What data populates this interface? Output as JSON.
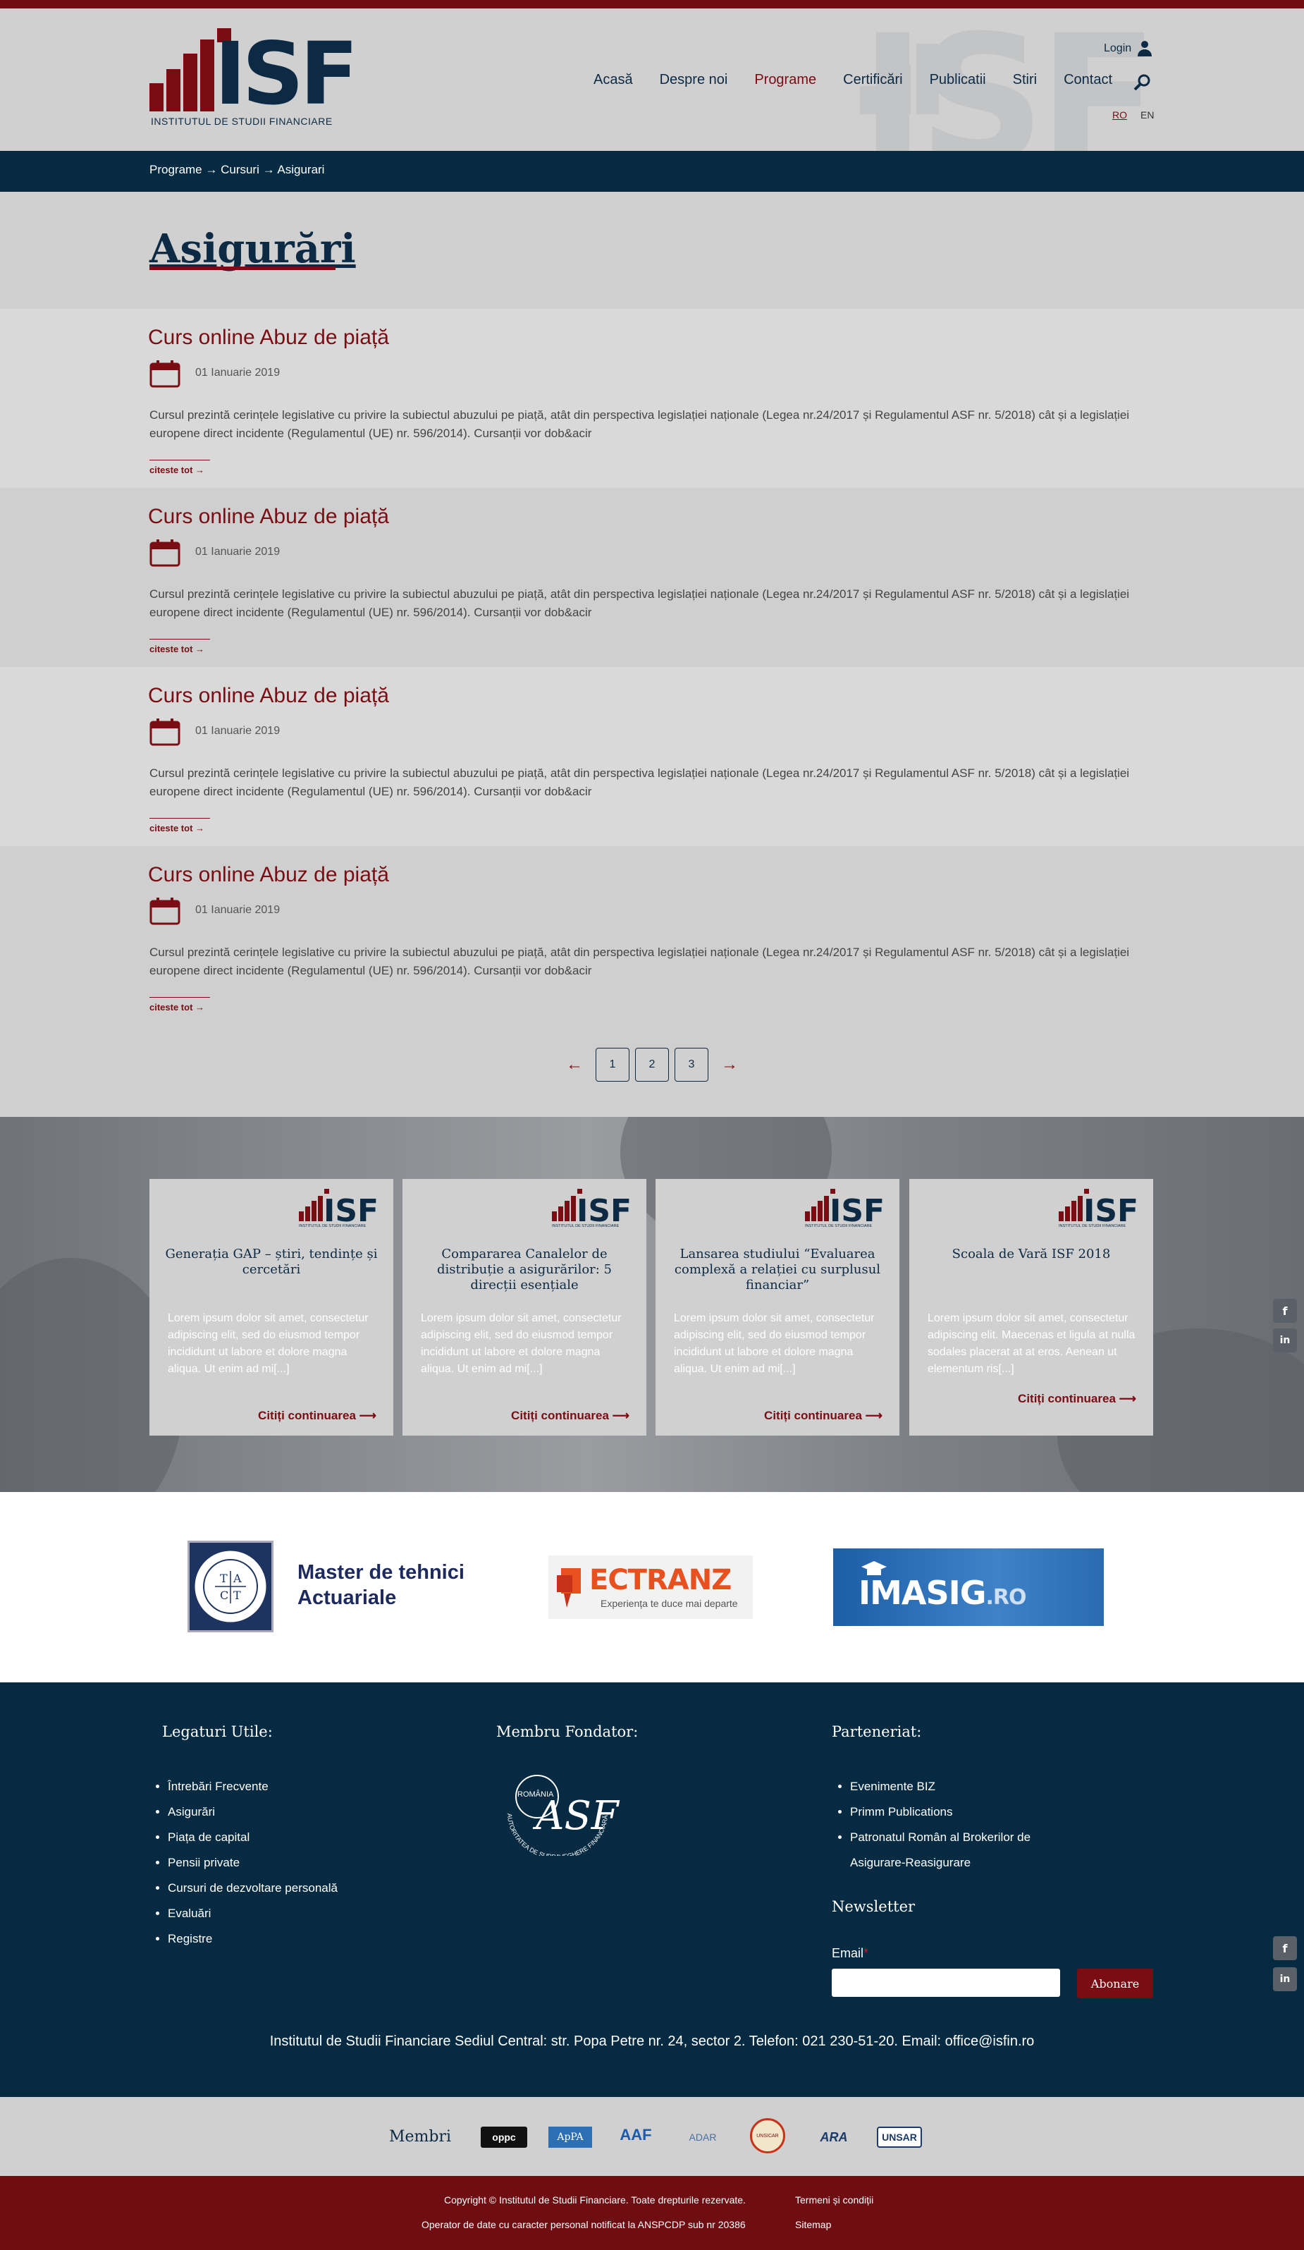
{
  "header": {
    "watermark": "ISF",
    "logo_text": "ISF",
    "logo_subtitle": "INSTITUTUL DE STUDII FINANCIARE",
    "nav": [
      "Acasă",
      "Despre noi",
      "Programe",
      "Certificări",
      "Publicatii",
      "Stiri",
      "Contact"
    ],
    "active_nav": "Programe",
    "login": "Login",
    "lang_ro": "RO",
    "lang_en": "EN"
  },
  "breadcrumb": "Programe → Cursuri → Asigurari",
  "page_title": "Asigurări",
  "posts": [
    {
      "title": "Curs online Abuz de piață",
      "date": "01 Ianuarie 2019",
      "excerpt": "Cursul prezintă cerințele legislative cu privire la subiectul abuzului pe piață, atât din perspectiva legislației naționale (Legea nr.24/2017 și Regulamentul ASF nr. 5/2018) cât și a legislației europene direct incidente (Regulamentul (UE) nr. 596/2014). Cursanții vor dob&acir",
      "more": "citeste tot →"
    },
    {
      "title": "Curs online Abuz de piață",
      "date": "01 Ianuarie 2019",
      "excerpt": "Cursul prezintă cerințele legislative cu privire la subiectul abuzului pe piață, atât din perspectiva legislației naționale (Legea nr.24/2017 și Regulamentul ASF nr. 5/2018) cât și a legislației europene direct incidente (Regulamentul (UE) nr. 596/2014). Cursanții vor dob&acir",
      "more": "citeste tot →"
    },
    {
      "title": "Curs online Abuz de piață",
      "date": "01 Ianuarie 2019",
      "excerpt": "Cursul prezintă cerințele legislative cu privire la subiectul abuzului pe piață, atât din perspectiva legislației naționale (Legea nr.24/2017 și Regulamentul ASF nr. 5/2018) cât și a legislației europene direct incidente (Regulamentul (UE) nr. 596/2014). Cursanții vor dob&acir",
      "more": "citeste tot →"
    },
    {
      "title": "Curs online Abuz de piață",
      "date": "01 Ianuarie 2019",
      "excerpt": "Cursul prezintă cerințele legislative cu privire la subiectul abuzului pe piață, atât din perspectiva legislației naționale (Legea nr.24/2017 și Regulamentul ASF nr. 5/2018) cât și a legislației europene direct incidente (Regulamentul (UE) nr. 596/2014). Cursanții vor dob&acir",
      "more": "citeste tot →"
    }
  ],
  "pagination": {
    "prev": "←",
    "pages": [
      "1",
      "2",
      "3"
    ],
    "next": "→"
  },
  "news_cards": [
    {
      "title": "Generația GAP – știri, tendințe și cercetări",
      "text": "Lorem ipsum dolor sit amet, consectetur adipiscing elit, sed do eiusmod tempor incididunt ut labore et dolore magna aliqua. Ut enim ad mi[...]",
      "more": "Citiți continuarea ⟶"
    },
    {
      "title": "Compararea Canalelor de distribuție a asigurărilor: 5 direcții esențiale",
      "text": "Lorem ipsum dolor sit amet, consectetur adipiscing elit, sed do eiusmod tempor incididunt ut labore et dolore magna aliqua. Ut enim ad mi[...]",
      "more": "Citiți continuarea ⟶"
    },
    {
      "title": "Lansarea studiului “Evaluarea complexă a relației cu surplusul financiar”",
      "text": "Lorem ipsum dolor sit amet, consectetur adipiscing elit, sed do eiusmod tempor incididunt ut labore et dolore magna aliqua. Ut enim ad mi[...]",
      "more": "Citiți continuarea ⟶"
    },
    {
      "title": "Scoala de Vară ISF 2018",
      "text": "Lorem ipsum dolor sit amet, consectetur adipiscing elit. Maecenas et ligula at nulla sodales placerat at at eros. Aenean ut elementum ris[...]",
      "more": "Citiți continuarea ⟶"
    }
  ],
  "card_logo": "ISF",
  "card_logo_sub": "INSTITUTUL DE STUDII FINANCIARE",
  "social": {
    "facebook": "f",
    "linkedin": "in"
  },
  "partners": {
    "master_line1": "Master de tehnici",
    "master_line2": "Actuariale",
    "master_badge_letters": [
      "T",
      "A",
      "C",
      "T"
    ],
    "ectranz": "ECTRANZ",
    "ectranz_tagline": "Experiența te duce mai departe",
    "imasig": "IMASIG",
    "imasig_tld": ".RO"
  },
  "footer": {
    "links_title": "Legaturi Utile:",
    "links": [
      "Întrebări Frecvente",
      "Asigurări",
      "Piața de capital",
      "Pensii private",
      "Cursuri de dezvoltare personală",
      "Evaluări",
      "Registre"
    ],
    "founder_title": "Membru Fondator:",
    "founder_text": "ROMÂNIA",
    "founder_arc": "AUTORITATEA DE SUPRAVEGHERE FINANCIARĂ",
    "partner_title": "Parteneriat:",
    "partner_links": [
      "Evenimente BIZ",
      "Primm Publications",
      "Patronatul Român al Brokerilor de",
      "Asigurare-Reasigurare"
    ],
    "newsletter_title": "Newsletter",
    "email_label": "Email",
    "required_mark": "*",
    "subscribe": "Abonare",
    "address": "Institutul de Studii Financiare Sediul Central: str. Popa Petre nr. 24, sector 2. Telefon: 021 230-51-20. Email: office@isfin.ro"
  },
  "members": {
    "label": "Membri",
    "logos": [
      "oppc",
      "ApPA",
      "AAF",
      "ADAR",
      "UNSICAR",
      "ARA",
      "UNSAR"
    ]
  },
  "bottom": {
    "copyright": "Copyright © Institutul de Studii Financiare. Toate drepturile rezervate.",
    "terms": "Termeni și condiții",
    "operator": "Operator de date cu caracter personal notificat la ANSPCDP sub nr 20386",
    "sitemap": "Sitemap"
  },
  "colors": {
    "brand_red": "#7a0d13",
    "navy": "#052a41"
  }
}
